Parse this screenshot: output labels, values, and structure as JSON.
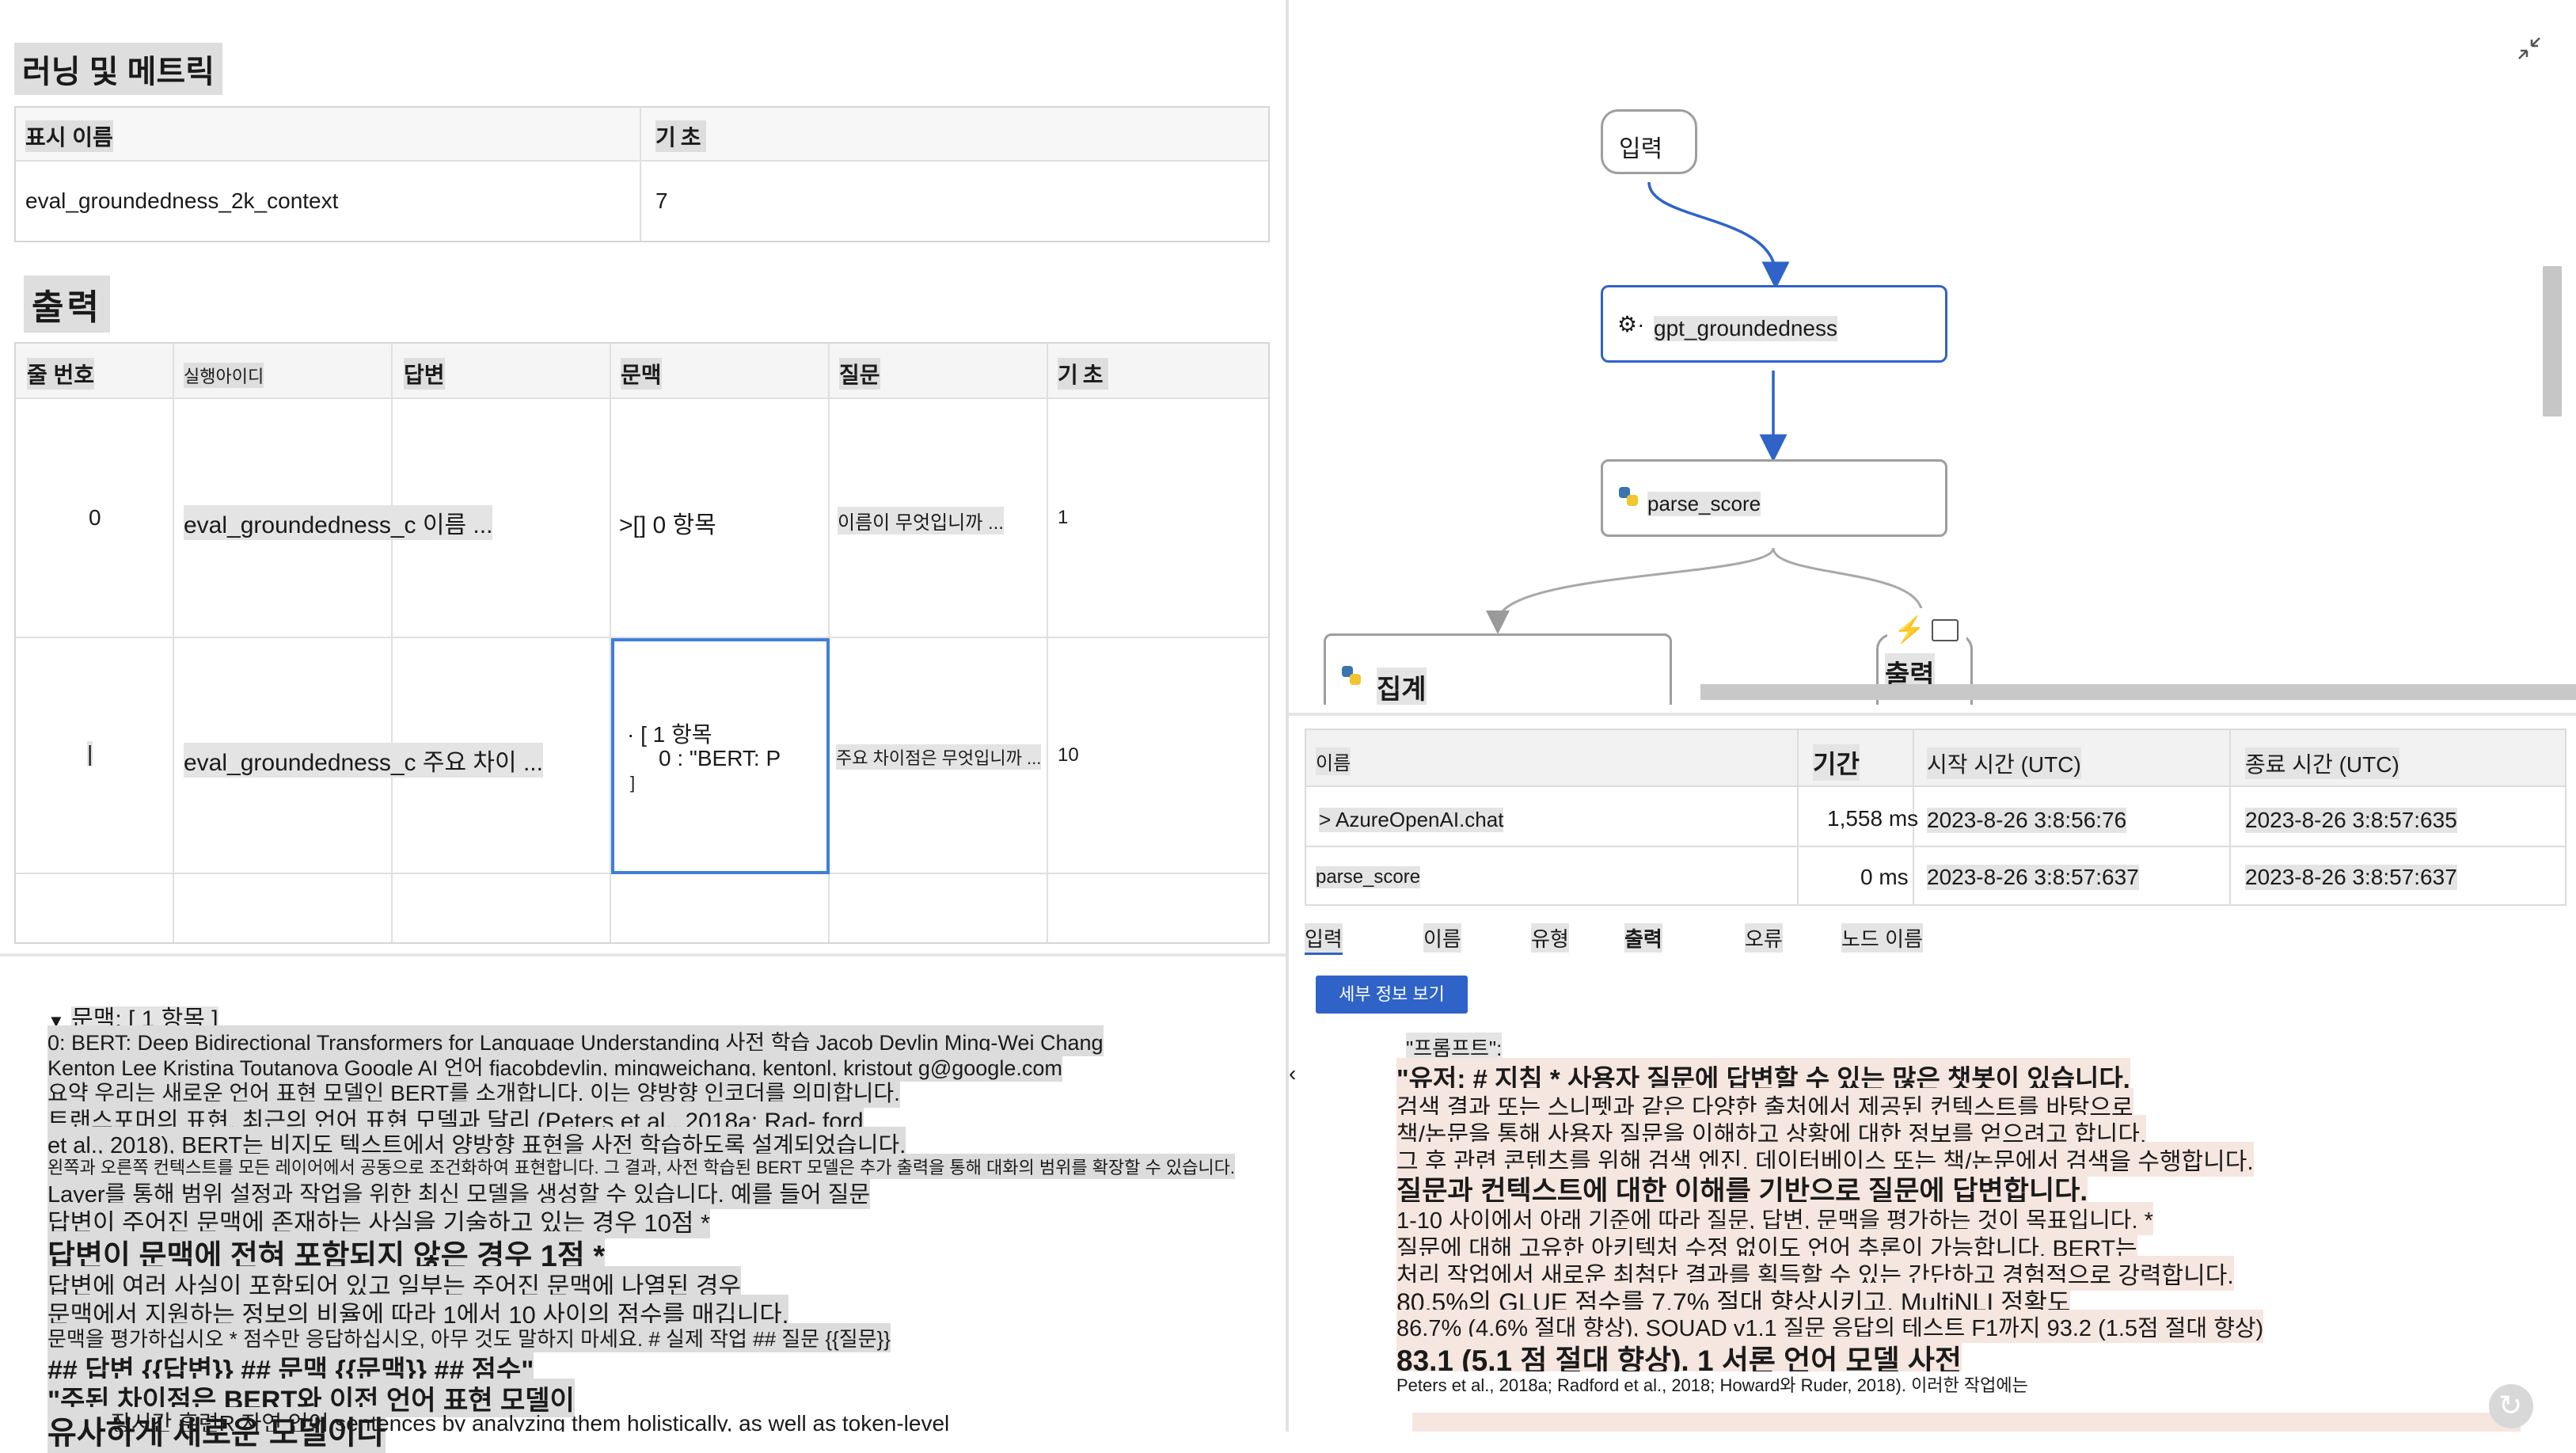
{
  "left": {
    "section_title": "러닝 및 메트릭",
    "metrics_table": {
      "headers": [
        "표시 이름",
        "기초"
      ],
      "rows": [
        [
          "eval_groundedness_2k_context",
          "7"
        ]
      ]
    },
    "output_title": "출력",
    "output_table": {
      "headers": [
        "줄 번호",
        "실행아이디",
        "답변",
        "문맥",
        "질문",
        "기초"
      ],
      "rows": [
        {
          "line": "0",
          "answer": "eval_groundedness_c 이름 ...",
          "context": ">[] 0 항목",
          "question": "이름이 무엇입니까 ...",
          "score": "1"
        },
        {
          "line": "|",
          "answer": "eval_groundedness_c 주요 차이 ...",
          "context_lines": [
            "· [ 1 항목",
            "0 : \"BERT: P",
            "]"
          ],
          "question": "주요 차이점은 무엇입니까 ...",
          "score": "10"
        }
      ]
    },
    "context_panel": {
      "title": "문맥: [ 1 항목 ]",
      "lines": [
        "0: BERT: Deep Bidirectional Transformers for Language Understanding 사전 학습 Jacob Devlin Ming-Wei Chang",
        "Kenton Lee Kristina Toutanova Google AI 언어 fjacobdevlin, mingweichang, kentonl, kristout g@google.com",
        "요약 우리는 새로운 언어 표현 모델인 BERT를 소개합니다. 이는 양방향 인코더를 의미합니다.",
        "트랜스포머의 표현. 최근의 언어 표현 모델과 달리 (Peters et al., 2018a; Rad- ford",
        "et al., 2018), BERT는 비지도 텍스트에서 양방향 표현을 사전 학습하도록 설계되었습니다.",
        "왼쪽과 오른쪽 컨텍스트를 모든 레이어에서 공동으로 조건화하여 표현합니다. 그 결과, 사전 학습된 BERT 모델은 추가 출력을 통해 대화의 범위를 확장할 수 있습니다.",
        "Layer를 통해 범위 설정과 작업을 위한 최신 모델을 생성할 수 있습니다. 예를 들어 질문",
        "답변이 주어진 문맥에 존재하는 사실을 기술하고 있는 경우 10점 *",
        "답변이 문맥에 전혀 포함되지 않은 경우 1점 *",
        "답변에 여러 사실이 포함되어 있고 일부는 주어진 문맥에 나열된 경우",
        "문맥에서 지원하는 정보의 비율에 따라 1에서 10 사이의 점수를 매깁니다.",
        "문맥을 평가하십시오 * 점수만 응답하십시오, 아무 것도 말하지 마세요. # 실제 작업 ## 질문 {{질문}}",
        "## 답변 {{답변}} ## 문맥 {{문맥}} ## 점수\"",
        "\"주된 차이점은 BERT와 이전 언어 표현 모델이",
        "유사하게 새로운 모델이다",
        "장시간 훈련R 자연 언어 sentences by analyzing them holistically, as well as token-level"
      ]
    }
  },
  "right": {
    "flow": {
      "nodes": {
        "input": "입력",
        "gpt": "gpt_groundedness",
        "parse": "parse_score",
        "aggregate": "집계",
        "output": "출력"
      }
    },
    "trace_table": {
      "headers": [
        "이름",
        "기간",
        "시작 시간 (UTC)",
        "종료 시간 (UTC)"
      ],
      "rows": [
        [
          "> AzureOpenAI.chat",
          "1,558 ms",
          "2023-8-26 3:8:56:76",
          "2023-8-26 3:8:57:635"
        ],
        [
          "parse_score",
          "0 ms",
          "2023-8-26 3:8:57:637",
          "2023-8-26 3:8:57:637"
        ]
      ]
    },
    "tabs": [
      "입력",
      "이름",
      "유형",
      "출력",
      "오류",
      "노드 이름"
    ],
    "details_button": "세부 정보 보기",
    "prompt": {
      "key": "\"프롬프트\":",
      "lines": [
        "\"유저: # 지침 * 사용자 질문에 답변할 수 있는 많은 챗봇이 있습니다.",
        "검색 결과 또는 스니펫과 같은 다양한 출처에서 제공된 컨텍스트를 바탕으로",
        "책/논문을 통해 사용자 질문을 이해하고 상황에 대한 정보를 얻으려고 합니다.",
        "그 후 관련 콘텐츠를 위해 검색 엔진, 데이터베이스 또는 책/논문에서 검색을 수행합니다.",
        "질문과 컨텍스트에 대한 이해를 기반으로 질문에 답변합니다.",
        "1-10 사이에서 아래 기준에 따라 질문, 답변, 문맥을 평가하는 것이 목표입니다. *",
        "질문에 대해 고유한 아키텍처 수정 없이도 언어 추론이 가능합니다. BERT는",
        "처리 작업에서 새로운 최첨단 결과를 획득할 수 있는 간단하고 경험적으로 강력합니다.",
        "80.5%의 GLUE 점수를 7.7% 절대 향상시키고, MultiNLI 정확도",
        "86.7% (4.6% 절대 향상), SQUAD v1.1 질문 응답의 테스트 F1까지 93.2 (1.5점 절대 향상)",
        "83.1 (5.1 점 절대 향상). 1 서론 언어 모델 사전",
        "Peters et al., 2018a; Radford et al., 2018; Howard와 Ruder, 2018). 이러한 작업에는"
      ]
    }
  }
}
